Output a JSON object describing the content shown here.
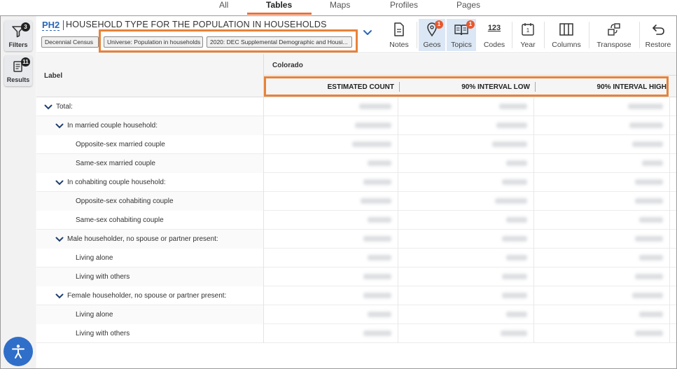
{
  "top_tabs": [
    {
      "label": "All"
    },
    {
      "label": "Tables"
    },
    {
      "label": "Maps"
    },
    {
      "label": "Profiles"
    },
    {
      "label": "Pages"
    }
  ],
  "rail": {
    "filters": {
      "label": "Filters",
      "count": "3"
    },
    "results": {
      "label": "Results",
      "count": "11"
    }
  },
  "table_header": {
    "id": "PH2",
    "title": "HOUSEHOLD TYPE FOR THE POPULATION IN HOUSEHOLDS",
    "chips": [
      "Decennial Census",
      "Universe: Population in households",
      "2020: DEC Supplemental Demographic and Housi..."
    ]
  },
  "toolbar": [
    {
      "label": "Notes",
      "icon": "notes-icon"
    },
    {
      "label": "Geos",
      "icon": "map-pin-icon",
      "badge": "1"
    },
    {
      "label": "Topics",
      "icon": "book-icon",
      "badge": "1"
    },
    {
      "label": "Codes",
      "icon": "codes-icon",
      "glyph": "123"
    },
    {
      "label": "Year",
      "icon": "calendar-icon",
      "glyph": "1"
    },
    {
      "label": "Columns",
      "icon": "columns-icon"
    },
    {
      "label": "Transpose",
      "icon": "transpose-icon"
    },
    {
      "label": "Restore",
      "icon": "restore-icon"
    }
  ],
  "table": {
    "label_header": "Label",
    "geo_header": "Colorado",
    "columns": [
      "ESTIMATED COUNT",
      "90% INTERVAL LOW",
      "90% INTERVAL HIGH"
    ],
    "rows": [
      {
        "label": "Total:",
        "level": 0,
        "expandable": true
      },
      {
        "label": "In married couple household:",
        "level": 1,
        "expandable": true
      },
      {
        "label": "Opposite-sex married couple",
        "level": 2,
        "expandable": false
      },
      {
        "label": "Same-sex married couple",
        "level": 2,
        "expandable": false
      },
      {
        "label": "In cohabiting couple household:",
        "level": 1,
        "expandable": true
      },
      {
        "label": "Opposite-sex cohabiting couple",
        "level": 2,
        "expandable": false
      },
      {
        "label": "Same-sex cohabiting couple",
        "level": 2,
        "expandable": false
      },
      {
        "label": "Male householder, no spouse or partner present:",
        "level": 1,
        "expandable": true
      },
      {
        "label": "Living alone",
        "level": 2,
        "expandable": false
      },
      {
        "label": "Living with others",
        "level": 2,
        "expandable": false
      },
      {
        "label": "Female householder, no spouse or partner present:",
        "level": 1,
        "expandable": true
      },
      {
        "label": "Living alone",
        "level": 2,
        "expandable": false
      },
      {
        "label": "Living with others",
        "level": 2,
        "expandable": false
      }
    ]
  },
  "colors": {
    "accent": "#e8703a",
    "highlight": "#e8823a",
    "link": "#2a67b8",
    "selected_tool": "#dbe7f5",
    "badge": "#e8582f",
    "accessibility": "#2f6fc9"
  }
}
